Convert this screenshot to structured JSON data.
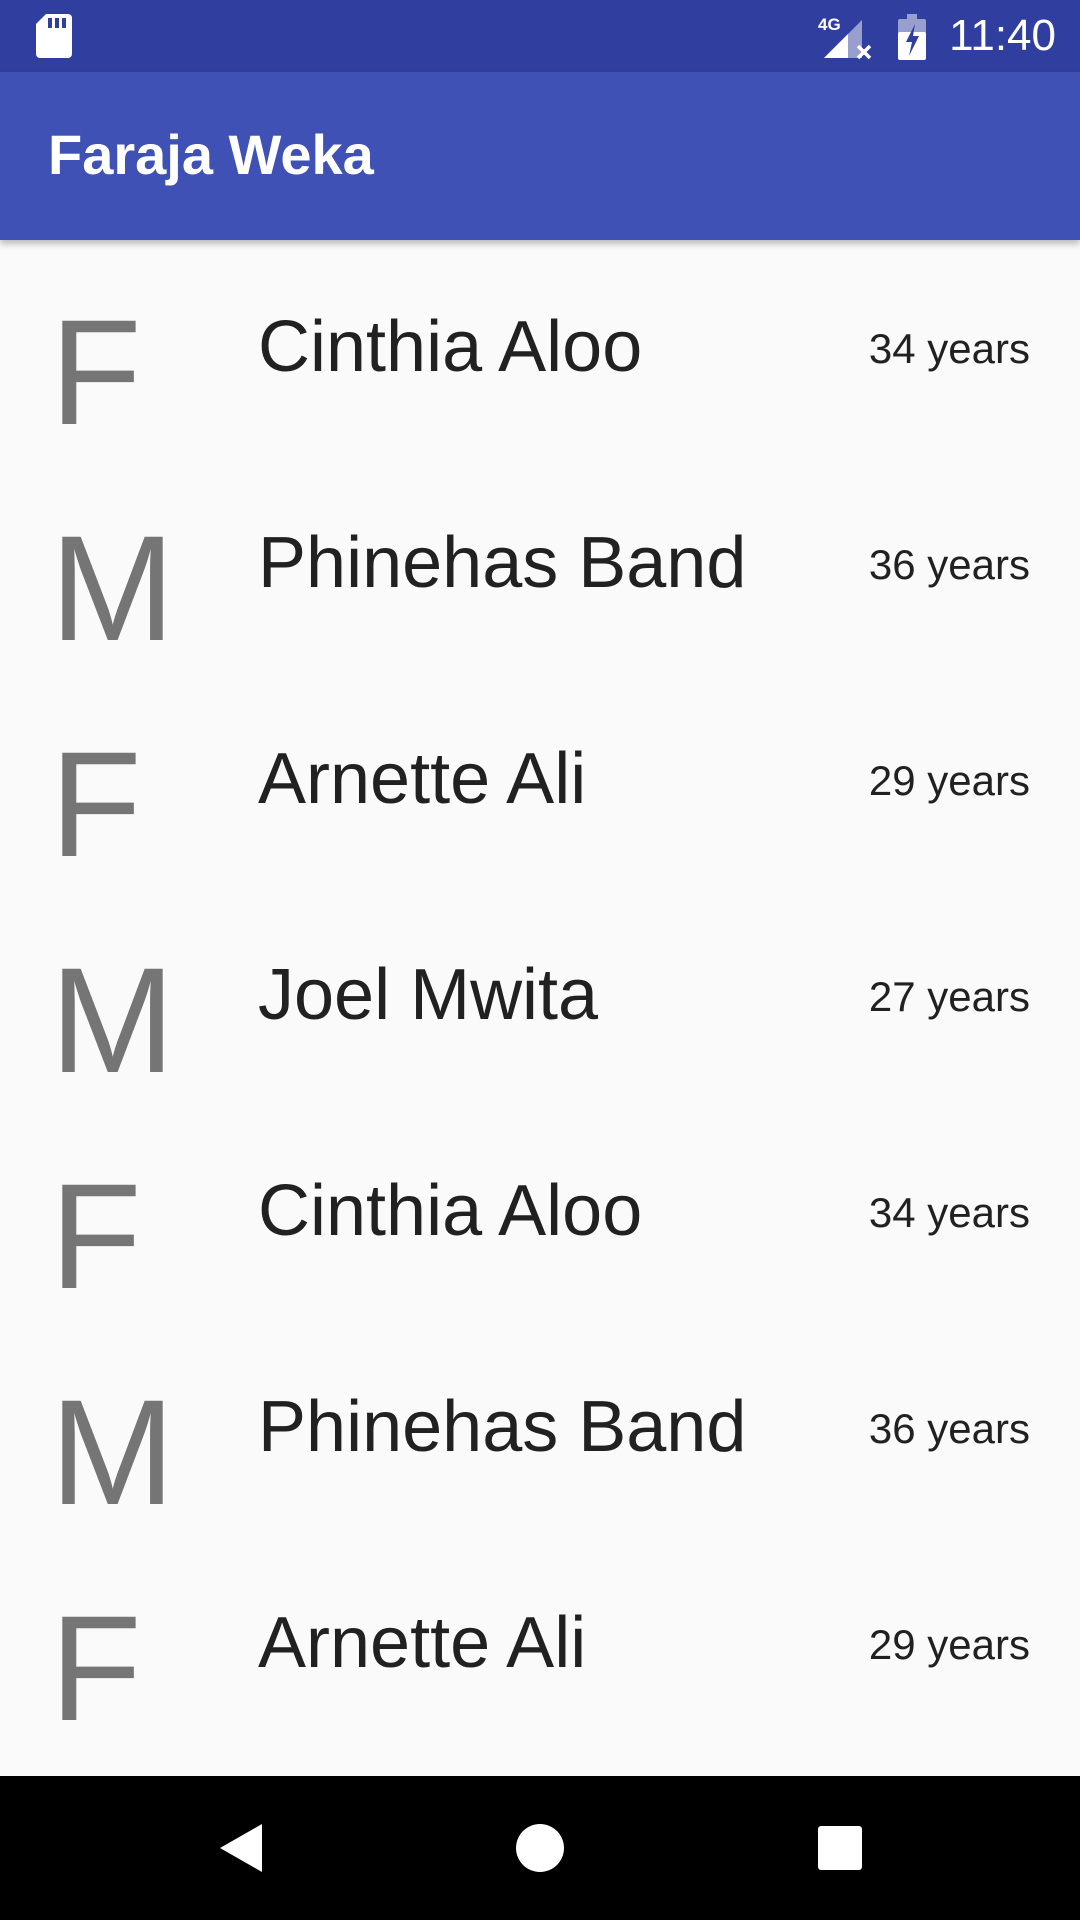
{
  "status_bar": {
    "network": "4G",
    "time": "11:40"
  },
  "app_bar": {
    "title": "Faraja Weka"
  },
  "people": [
    {
      "gender": "F",
      "name": "Cinthia Aloo",
      "age": "34 years"
    },
    {
      "gender": "M",
      "name": "Phinehas Band",
      "age": "36 years"
    },
    {
      "gender": "F",
      "name": "Arnette Ali",
      "age": "29 years"
    },
    {
      "gender": "M",
      "name": "Joel Mwita",
      "age": "27 years"
    },
    {
      "gender": "F",
      "name": "Cinthia Aloo",
      "age": "34 years"
    },
    {
      "gender": "M",
      "name": "Phinehas Band",
      "age": "36 years"
    },
    {
      "gender": "F",
      "name": "Arnette Ali",
      "age": "29 years"
    }
  ],
  "nav_bar": {
    "buttons": [
      "back-icon",
      "home-icon",
      "recents-icon"
    ]
  },
  "colors": {
    "status_bar": "#303f9f",
    "app_bar": "#3f51b5",
    "background": "#fafafa",
    "gender_letter": "#757575",
    "text": "#212121",
    "nav_bar": "#000000"
  }
}
